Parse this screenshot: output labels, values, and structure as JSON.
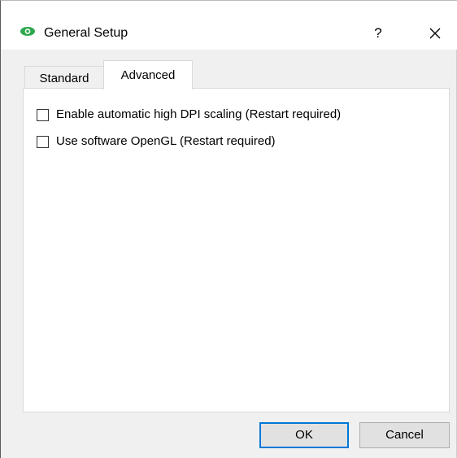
{
  "window": {
    "title": "General Setup",
    "help_label": "?",
    "app_icon": "eye-logo-icon",
    "close_icon": "close-icon"
  },
  "tabs": [
    {
      "label": "Standard",
      "selected": false
    },
    {
      "label": "Advanced",
      "selected": true
    }
  ],
  "options": [
    {
      "label": "Enable automatic high DPI scaling (Restart required)",
      "checked": false
    },
    {
      "label": "Use software OpenGL (Restart required)",
      "checked": false
    }
  ],
  "buttons": {
    "ok_label": "OK",
    "cancel_label": "Cancel"
  },
  "colors": {
    "accent": "#0078d7",
    "icon_green": "#2ea84f",
    "dialog_background": "#f0f0f0",
    "panel_background": "#ffffff"
  }
}
